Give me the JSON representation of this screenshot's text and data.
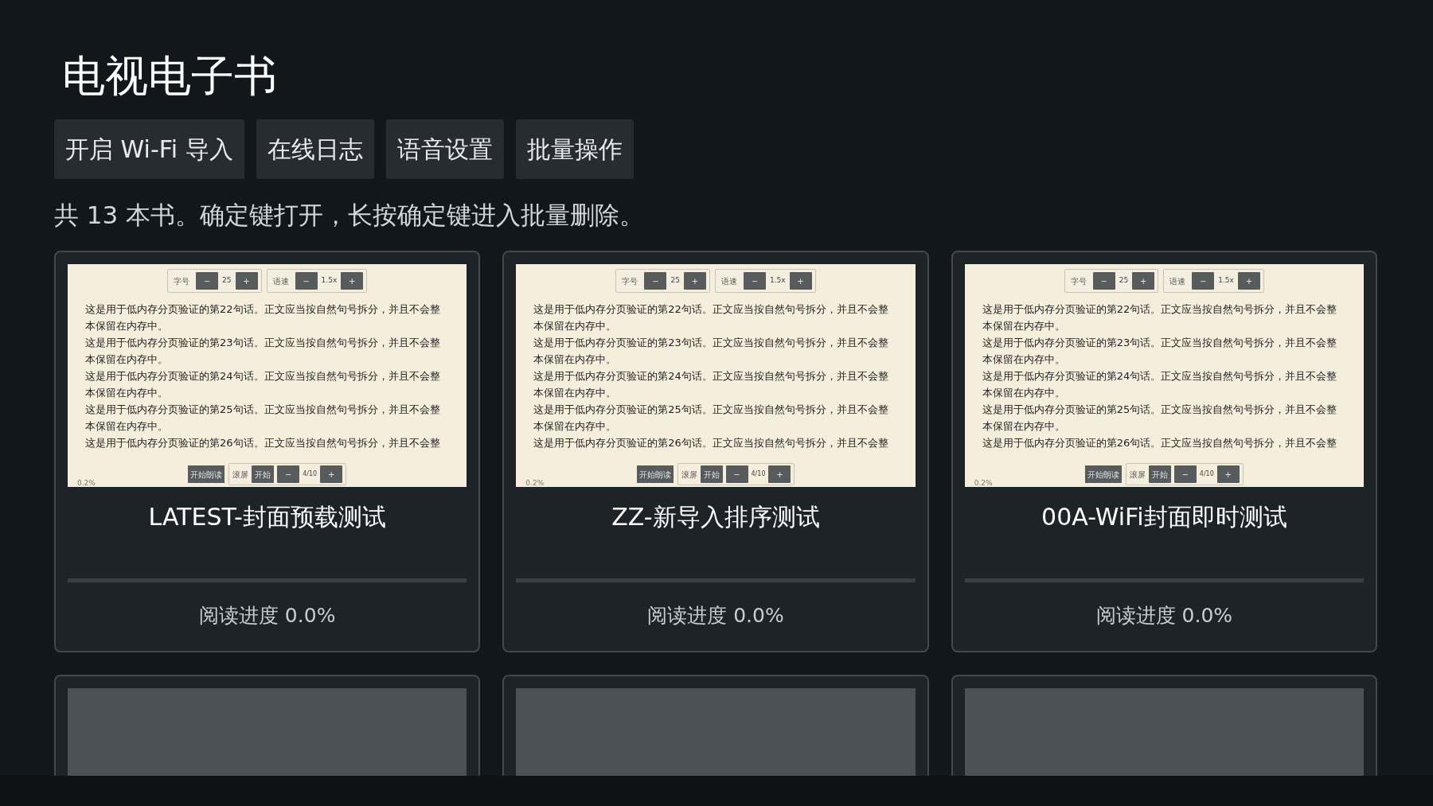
{
  "title": "电视电子书",
  "actions": [
    {
      "label": "开启 Wi-Fi 导入"
    },
    {
      "label": "在线日志"
    },
    {
      "label": "语音设置"
    },
    {
      "label": "批量操作"
    }
  ],
  "summary": "共 13 本书。确定键打开，长按确定键进入批量删除。",
  "books": [
    {
      "title": "LATEST-封面预载测试",
      "progress": "阅读进度 0.0%",
      "level": 0,
      "cover": {
        "kind": "page",
        "top_controls": [
          {
            "label": "字号",
            "minus": "−",
            "value": "25",
            "plus": "+"
          },
          {
            "label": "语速",
            "minus": "−",
            "value": "1.5x",
            "plus": "+"
          }
        ],
        "lines": [
          "这是用于低内存分页验证的第22句话。正文应当按自然句号拆分，并且不会整",
          "本保留在内存中。",
          "这是用于低内存分页验证的第23句话。正文应当按自然句号拆分，并且不会整",
          "本保留在内存中。",
          "这是用于低内存分页验证的第24句话。正文应当按自然句号拆分，并且不会整",
          "本保留在内存中。",
          "这是用于低内存分页验证的第25句话。正文应当按自然句号拆分，并且不会整",
          "本保留在内存中。",
          "这是用于低内存分页验证的第26句话。正文应当按自然句号拆分，并且不会整"
        ],
        "read_button": "开始朗读",
        "scroll": {
          "label": "滚屏",
          "start": "开始",
          "minus": "−",
          "value": "4/10",
          "plus": "+"
        },
        "percent": "0.2%"
      }
    },
    {
      "title": "ZZ-新导入排序测试",
      "progress": "阅读进度 0.0%",
      "level": 0,
      "cover": {
        "kind": "page",
        "top_controls": [
          {
            "label": "字号",
            "minus": "−",
            "value": "25",
            "plus": "+"
          },
          {
            "label": "语速",
            "minus": "−",
            "value": "1.5x",
            "plus": "+"
          }
        ],
        "lines": [
          "这是用于低内存分页验证的第22句话。正文应当按自然句号拆分，并且不会整",
          "本保留在内存中。",
          "这是用于低内存分页验证的第23句话。正文应当按自然句号拆分，并且不会整",
          "本保留在内存中。",
          "这是用于低内存分页验证的第24句话。正文应当按自然句号拆分，并且不会整",
          "本保留在内存中。",
          "这是用于低内存分页验证的第25句话。正文应当按自然句号拆分，并且不会整",
          "本保留在内存中。",
          "这是用于低内存分页验证的第26句话。正文应当按自然句号拆分，并且不会整"
        ],
        "read_button": "开始朗读",
        "scroll": {
          "label": "滚屏",
          "start": "开始",
          "minus": "−",
          "value": "4/10",
          "plus": "+"
        },
        "percent": "0.2%"
      }
    },
    {
      "title": "00A-WiFi封面即时测试",
      "progress": "阅读进度 0.0%",
      "level": 0,
      "cover": {
        "kind": "page",
        "top_controls": [
          {
            "label": "字号",
            "minus": "−",
            "value": "25",
            "plus": "+"
          },
          {
            "label": "语速",
            "minus": "−",
            "value": "1.5x",
            "plus": "+"
          }
        ],
        "lines": [
          "这是用于低内存分页验证的第22句话。正文应当按自然句号拆分，并且不会整",
          "本保留在内存中。",
          "这是用于低内存分页验证的第23句话。正文应当按自然句号拆分，并且不会整",
          "本保留在内存中。",
          "这是用于低内存分页验证的第24句话。正文应当按自然句号拆分，并且不会整",
          "本保留在内存中。",
          "这是用于低内存分页验证的第25句话。正文应当按自然句号拆分，并且不会整",
          "本保留在内存中。",
          "这是用于低内存分页验证的第26句话。正文应当按自然句号拆分，并且不会整"
        ],
        "read_button": "开始朗读",
        "scroll": {
          "label": "滚屏",
          "start": "开始",
          "minus": "−",
          "value": "4/10",
          "plus": "+"
        },
        "percent": "0.2%"
      }
    },
    {
      "cover": {
        "kind": "blank"
      }
    },
    {
      "cover": {
        "kind": "blank"
      }
    },
    {
      "cover": {
        "kind": "blank"
      }
    }
  ]
}
